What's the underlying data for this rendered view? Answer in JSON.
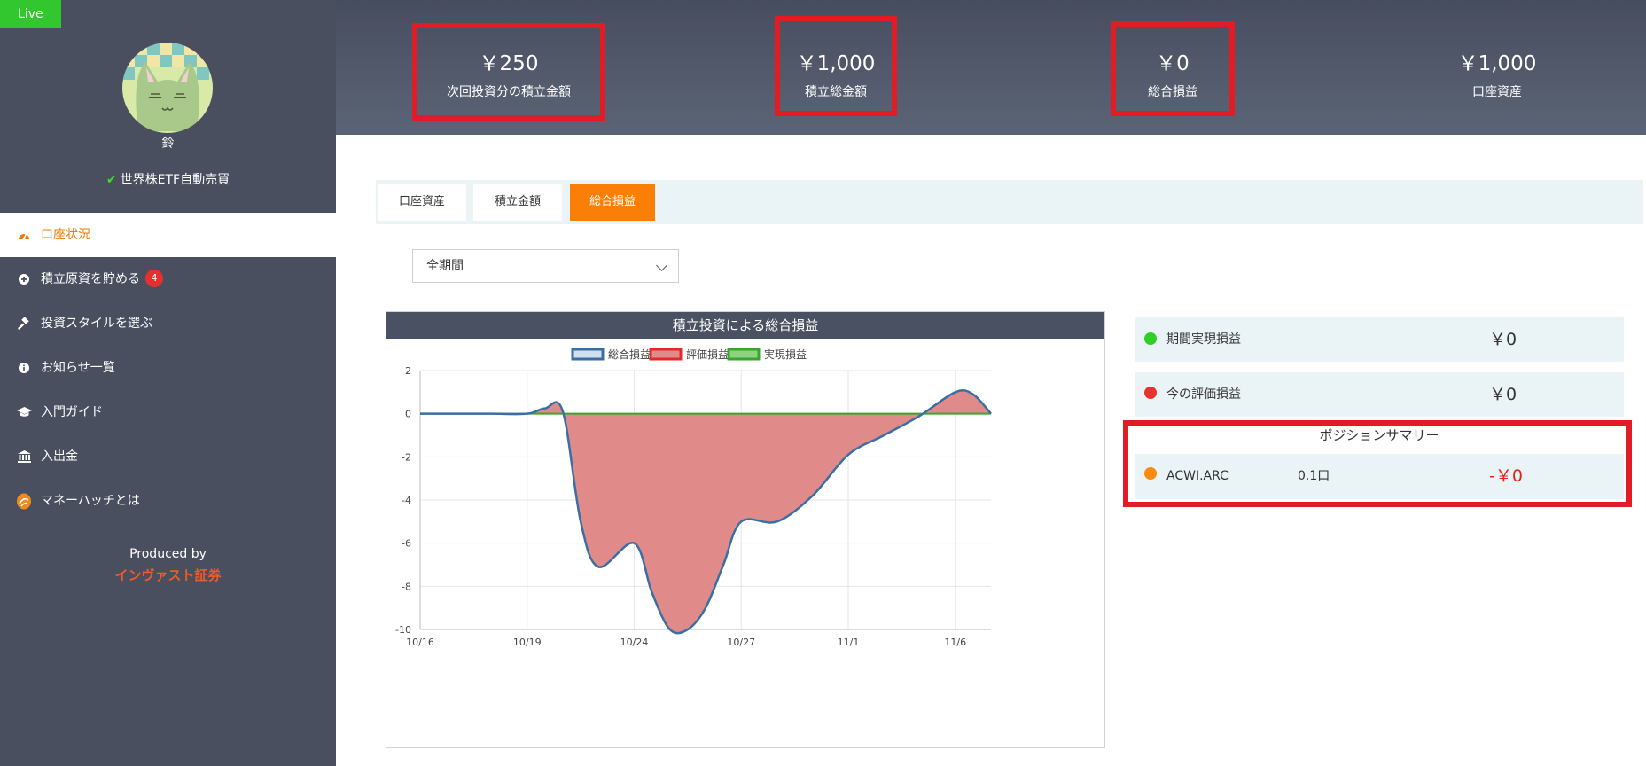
{
  "status": {
    "live_label": "Live"
  },
  "user": {
    "name": "鈴",
    "strategy": "世界株ETF自動売買"
  },
  "nav": {
    "items": [
      {
        "label": "口座状況",
        "icon": "gauge-icon",
        "active": true
      },
      {
        "label": "積立原資を貯める",
        "icon": "plus-circle-icon",
        "badge": "4"
      },
      {
        "label": "投資スタイルを選ぶ",
        "icon": "gavel-icon"
      },
      {
        "label": "お知らせ一覧",
        "icon": "info-circle-icon"
      },
      {
        "label": "入門ガイド",
        "icon": "graduation-cap-icon"
      },
      {
        "label": "入出金",
        "icon": "bank-icon"
      },
      {
        "label": "マネーハッチとは",
        "icon": "moneyhatch-logo-icon"
      }
    ]
  },
  "footer": {
    "produced_by": "Produced by",
    "company": "インヴァスト証券"
  },
  "header": {
    "stats": [
      {
        "value": "￥250",
        "label": "次回投資分の積立金額",
        "highlighted": true
      },
      {
        "value": "￥1,000",
        "label": "積立総金額",
        "highlighted": true
      },
      {
        "value": "￥0",
        "label": "総合損益",
        "highlighted": true
      },
      {
        "value": "￥1,000",
        "label": "口座資産",
        "highlighted": false
      }
    ]
  },
  "tabs": [
    {
      "label": "口座資産",
      "active": false
    },
    {
      "label": "積立金額",
      "active": false
    },
    {
      "label": "総合損益",
      "active": true
    }
  ],
  "period_select": {
    "value": "全期間"
  },
  "chart_data": {
    "type": "area",
    "title": "積立投資による総合損益",
    "legend": [
      "総合損益",
      "評価損益",
      "実現損益"
    ],
    "legend_position": "top",
    "x_ticks": [
      "10/16",
      "10/19",
      "10/24",
      "10/27",
      "11/1",
      "11/6"
    ],
    "x_tick_index": [
      0,
      3,
      6,
      9,
      12,
      15
    ],
    "ylim": [
      -10,
      2
    ],
    "y_ticks": [
      2,
      0,
      -2,
      -4,
      -6,
      -8,
      -10
    ],
    "grid": true,
    "x_index": [
      0,
      1,
      2,
      3,
      3.5,
      4,
      4.5,
      5,
      6,
      6.5,
      7,
      7.5,
      8,
      8.5,
      9,
      10,
      11,
      12,
      13,
      14,
      15,
      15.5,
      16
    ],
    "series": [
      {
        "name": "総合損益",
        "color": "#3b6ea5",
        "values": [
          0,
          0,
          0,
          0,
          0.25,
          0.1,
          -5.0,
          -7.1,
          -6.0,
          -8.3,
          -10.0,
          -10.0,
          -9.0,
          -7.0,
          -5.0,
          -5.0,
          -3.8,
          -1.9,
          -1.0,
          -0.1,
          1.0,
          0.9,
          0
        ]
      },
      {
        "name": "評価損益",
        "color": "#e02b2b",
        "fill": "#e08a8a",
        "values": [
          0,
          0,
          0,
          0,
          0.25,
          0.1,
          -5.0,
          -7.1,
          -6.0,
          -8.3,
          -10.0,
          -10.0,
          -9.0,
          -7.0,
          -5.0,
          -5.0,
          -3.8,
          -1.9,
          -1.0,
          -0.1,
          1.0,
          0.9,
          0
        ]
      },
      {
        "name": "実現損益",
        "color": "#3aa52c",
        "fill": "#8ed27f",
        "values": [
          0,
          0,
          0,
          0,
          0,
          0,
          0,
          0,
          0,
          0,
          0,
          0,
          0,
          0,
          0,
          0,
          0,
          0,
          0,
          0,
          0,
          0,
          0
        ]
      }
    ]
  },
  "summary": {
    "realized": {
      "label": "期間実現損益",
      "value": "￥0",
      "color": "#2fd024"
    },
    "unrealized": {
      "label": "今の評価損益",
      "value": "￥0",
      "color": "#e9322f"
    },
    "position_title": "ポジションサマリー",
    "positions": [
      {
        "symbol": "ACWI.ARC",
        "quantity": "0.1口",
        "pl": "-￥0",
        "color": "#fb8a10"
      }
    ]
  }
}
